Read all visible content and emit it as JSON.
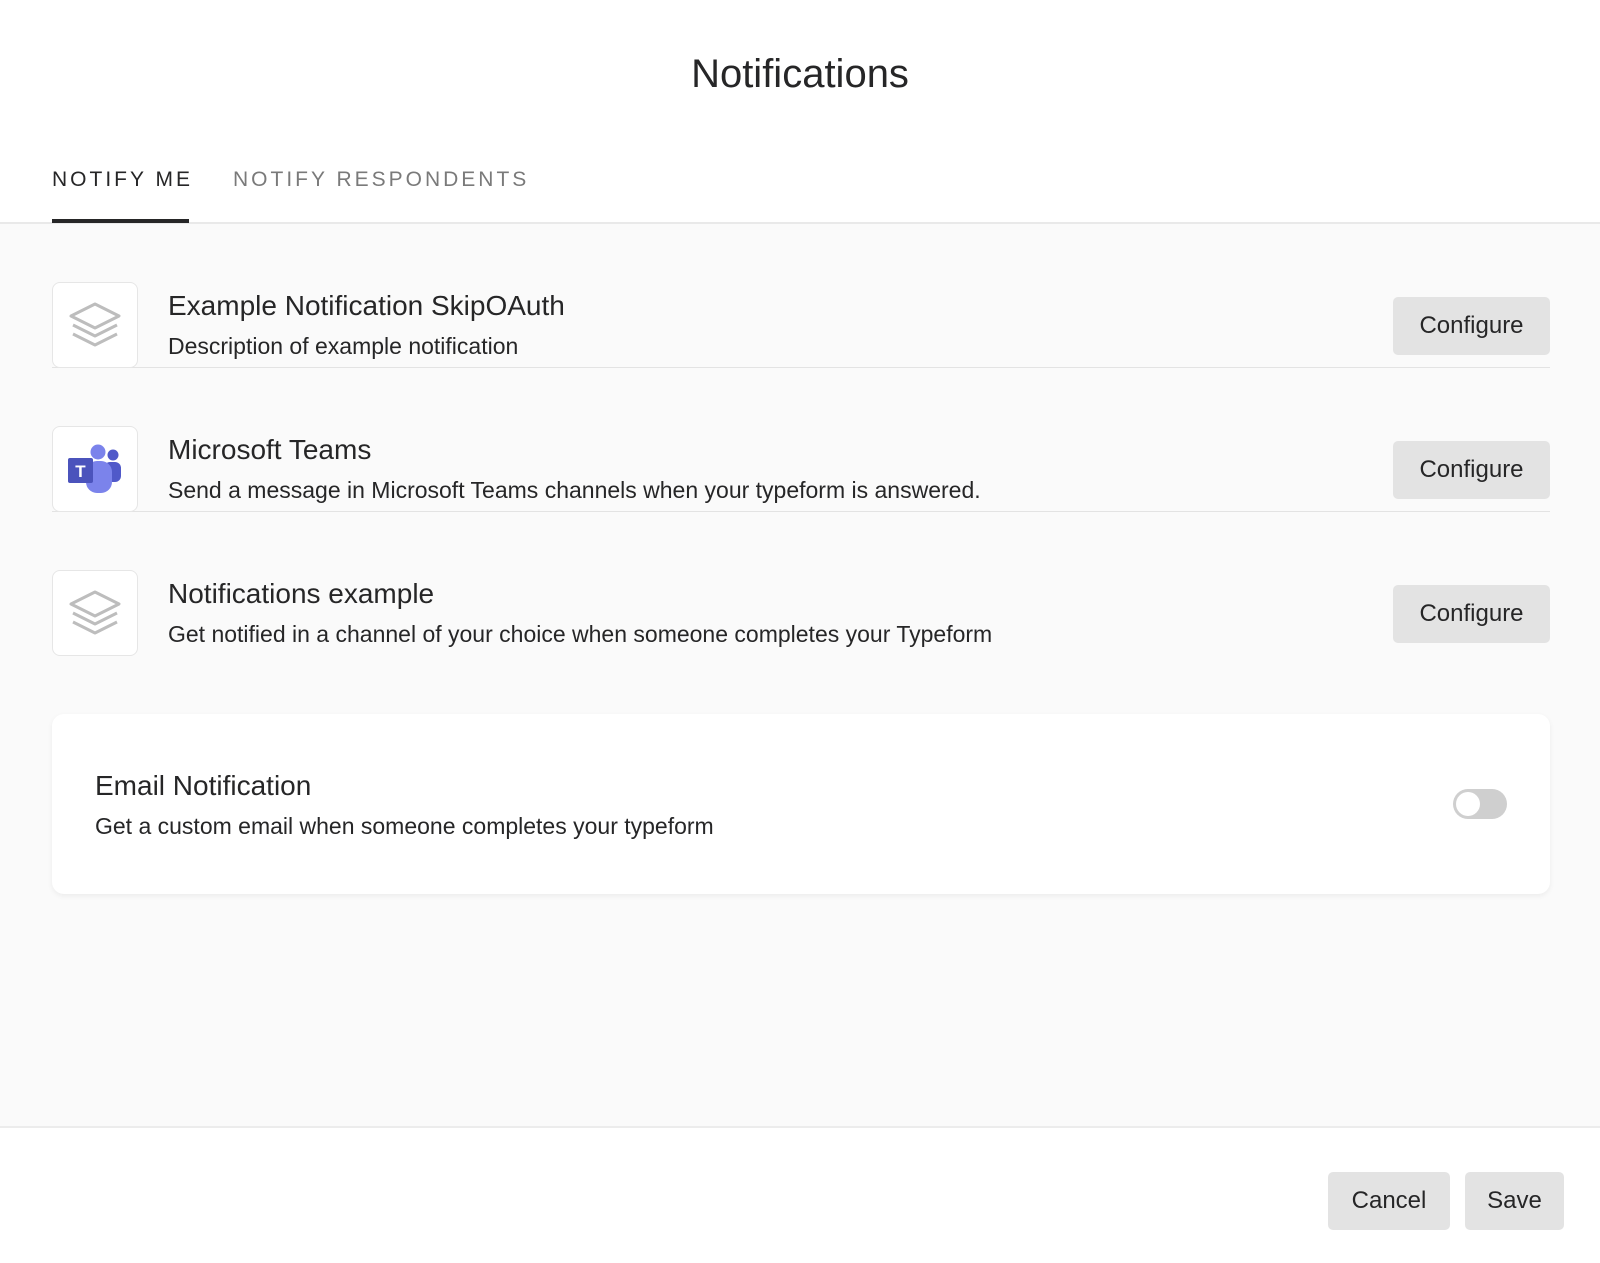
{
  "title": "Notifications",
  "tabs": [
    {
      "label": "NOTIFY ME",
      "active": true
    },
    {
      "label": "NOTIFY RESPONDENTS",
      "active": false
    }
  ],
  "integrations": [
    {
      "title": "Example Notification SkipOAuth",
      "description": "Description of example notification",
      "icon": "layers-icon",
      "button_label": "Configure"
    },
    {
      "title": "Microsoft Teams",
      "description": "Send a message in Microsoft Teams channels when your typeform is answered.",
      "icon": "microsoft-teams-icon",
      "button_label": "Configure"
    },
    {
      "title": "Notifications example",
      "description": "Get notified in a channel of your choice when someone completes your Typeform",
      "icon": "layers-icon",
      "button_label": "Configure"
    }
  ],
  "email_notification": {
    "title": "Email Notification",
    "description": "Get a custom email when someone completes your typeform",
    "enabled": false
  },
  "footer": {
    "cancel_label": "Cancel",
    "save_label": "Save"
  },
  "colors": {
    "text": "#262627",
    "muted_tab": "#7a7a7a",
    "button_bg": "#e3e3e3",
    "content_bg": "#fafafa",
    "teams_purple": "#5059c9"
  }
}
